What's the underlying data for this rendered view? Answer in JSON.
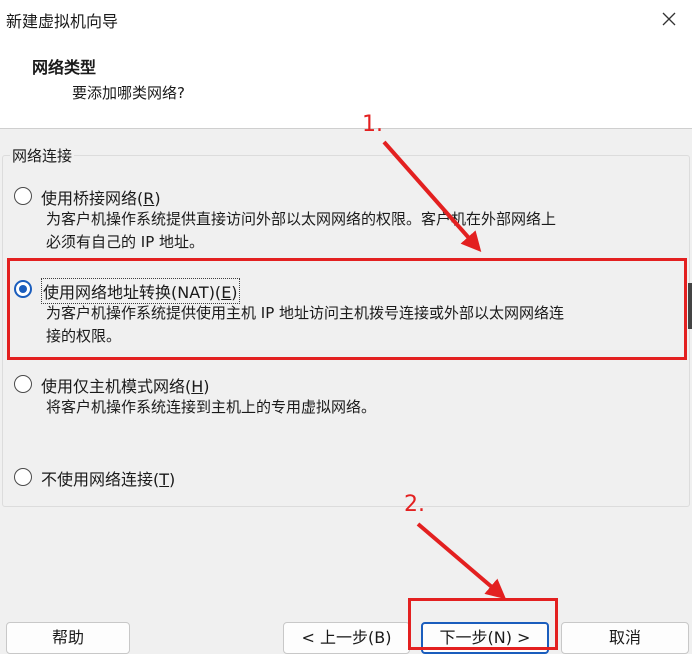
{
  "window": {
    "title": "新建虚拟机向导"
  },
  "header": {
    "title": "网络类型",
    "subtitle": "要添加哪类网络?"
  },
  "network_group": {
    "legend": "网络连接",
    "options": [
      {
        "label": "使用桥接网络(",
        "accel": "R",
        "label_end": ")",
        "selected": false,
        "description": "为客户机操作系统提供直接访问外部以太网网络的权限。客户机在外部网络上\n必须有自己的 IP 地址。"
      },
      {
        "label": "使用网络地址转换(NAT)(",
        "accel": "E",
        "label_end": ")",
        "selected": true,
        "description": "为客户机操作系统提供使用主机 IP 地址访问主机拨号连接或外部以太网网络连\n接的权限。"
      },
      {
        "label": "使用仅主机模式网络(",
        "accel": "H",
        "label_end": ")",
        "selected": false,
        "description": "将客户机操作系统连接到主机上的专用虚拟网络。"
      },
      {
        "label": "不使用网络连接(",
        "accel": "T",
        "label_end": ")",
        "selected": false,
        "description": ""
      }
    ]
  },
  "annotations": {
    "step1": "1.",
    "step2": "2.",
    "color": "#e32020"
  },
  "buttons": {
    "help": "帮助",
    "back": "< 上一步(B)",
    "next": "下一步(N) >",
    "cancel": "取消"
  },
  "colors": {
    "accent": "#1a5dbd",
    "highlight": "#e32020"
  }
}
